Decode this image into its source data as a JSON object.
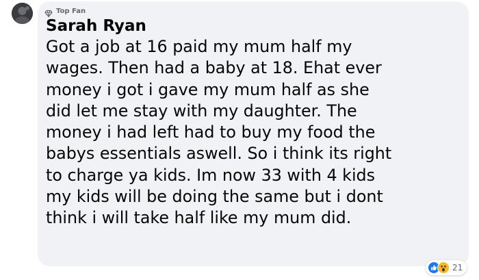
{
  "comment": {
    "badge": "Top Fan",
    "author": "Sarah Ryan",
    "lines": [
      "Got a job at 16 paid my mum half my",
      "wages. Then had a baby at 18. Ehat ever",
      "money i got i gave my mum half as she",
      "did let me stay with my daughter. The",
      "money i had left had to buy my food the",
      "babys essentials aswell. So i think its right",
      "to charge ya kids. Im now 33 with 4 kids",
      "my kids will be doing the same but i dont",
      "think i will take half like my mum did."
    ]
  },
  "reactions": {
    "icons": [
      "like-icon",
      "wow-icon"
    ],
    "count": "21"
  },
  "colors": {
    "bubble_bg": "#f0f2f5",
    "text": "#050505",
    "secondary_text": "#65676b",
    "like_blue": "#1877f2",
    "wow_yellow": "#f7b928"
  }
}
